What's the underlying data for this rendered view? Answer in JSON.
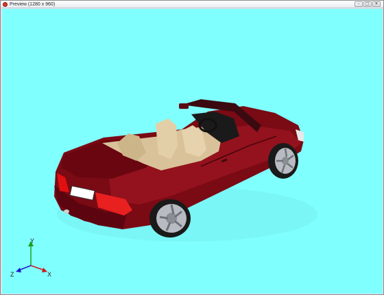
{
  "window": {
    "title": "Preview (1280 x 960)",
    "controls": {
      "minimize": "–",
      "maximize": "□",
      "close": "✕"
    }
  },
  "viewport": {
    "background_color": "#80ffff",
    "model": "red convertible car, 3D render",
    "axis_gizmo": {
      "labels": [
        "Y",
        "Z",
        "X"
      ],
      "colors": {
        "y": "#1aa01a",
        "z": "#1a1acc",
        "x": "#cc1a1a"
      }
    }
  }
}
